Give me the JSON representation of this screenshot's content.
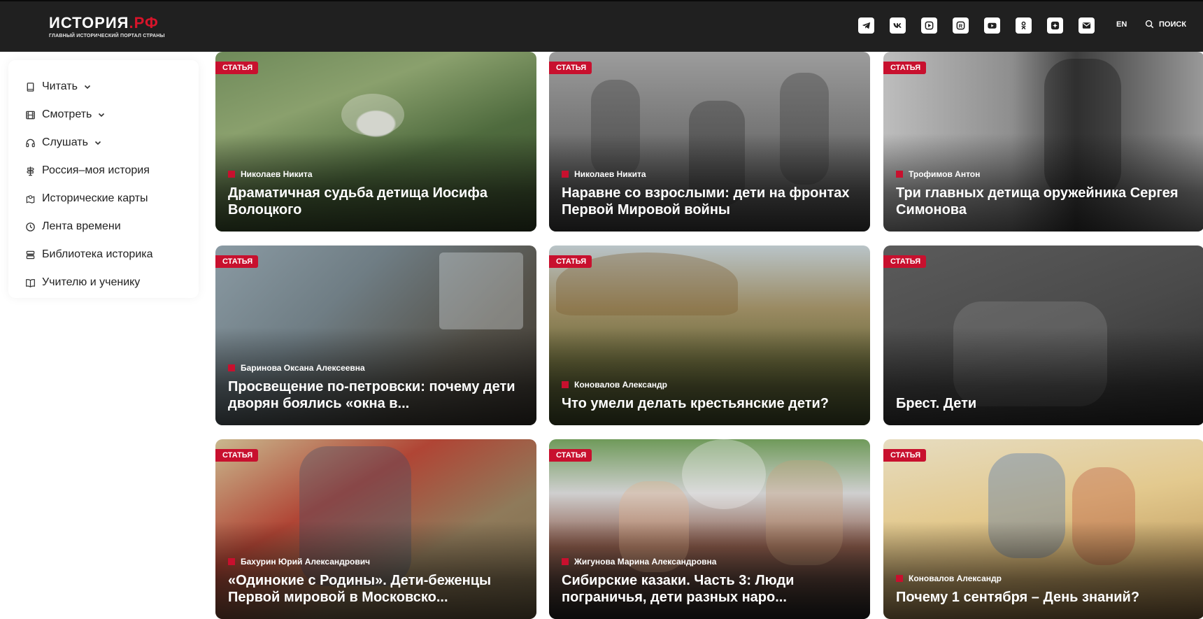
{
  "header": {
    "logo_main": "ИСТОРИЯ",
    "logo_suffix": ".РФ",
    "logo_sub": "ГЛАВНЫЙ ИСТОРИЧЕСКИЙ ПОРТАЛ СТРАНЫ",
    "socials": [
      "telegram-icon",
      "vk-icon",
      "play-icon",
      "rutube-icon",
      "youtube-icon",
      "ok-icon",
      "dzen-icon",
      "mail-icon"
    ],
    "lang": "EN",
    "search_label": "ПОИСК"
  },
  "sidebar": {
    "items": [
      {
        "label": "Читать",
        "icon": "book-icon",
        "dropdown": true
      },
      {
        "label": "Смотреть",
        "icon": "film-icon",
        "dropdown": true
      },
      {
        "label": "Слушать",
        "icon": "headphones-icon",
        "dropdown": true
      },
      {
        "label": "Россия–моя история",
        "icon": "signpost-icon",
        "dropdown": false
      },
      {
        "label": "Исторические карты",
        "icon": "map-icon",
        "dropdown": false
      },
      {
        "label": "Лента времени",
        "icon": "clock-icon",
        "dropdown": false
      },
      {
        "label": "Библиотека историка",
        "icon": "library-icon",
        "dropdown": false
      },
      {
        "label": "Учителю и ученику",
        "icon": "open-book-icon",
        "dropdown": false
      }
    ]
  },
  "cards": [
    {
      "badge": "СТАТЬЯ",
      "author": "Николаев Никита",
      "title": "Драматичная судьба детища Иосифа Волоцкого"
    },
    {
      "badge": "СТАТЬЯ",
      "author": "Николаев Никита",
      "title": "Наравне со взрослыми: дети на фронтах Первой Мировой войны"
    },
    {
      "badge": "СТАТЬЯ",
      "author": "Трофимов Антон",
      "title": "Три главных детища оружейника Сергея Симонова"
    },
    {
      "badge": "СТАТЬЯ",
      "author": "Баринова Оксана Алексеевна",
      "title": "Просвещение по-петровски: почему дети дворян боялись «окна в..."
    },
    {
      "badge": "СТАТЬЯ",
      "author": "Коновалов Александр",
      "title": "Что умели делать крестьянские дети?"
    },
    {
      "badge": "СТАТЬЯ",
      "author": "",
      "title": "Брест. Дети"
    },
    {
      "badge": "СТАТЬЯ",
      "author": "Бахурин Юрий Александрович",
      "title": "«Одинокие с Родины». Дети-беженцы Первой мировой в Московско..."
    },
    {
      "badge": "СТАТЬЯ",
      "author": "Жигунова Марина Александровна",
      "title": "Сибирские казаки. Часть 3: Люди пограничья, дети разных наро..."
    },
    {
      "badge": "СТАТЬЯ",
      "author": "Коновалов Александр",
      "title": "Почему 1 сентября – День знаний?"
    }
  ],
  "colors": {
    "accent": "#c8102e",
    "header_bg": "#202020"
  }
}
